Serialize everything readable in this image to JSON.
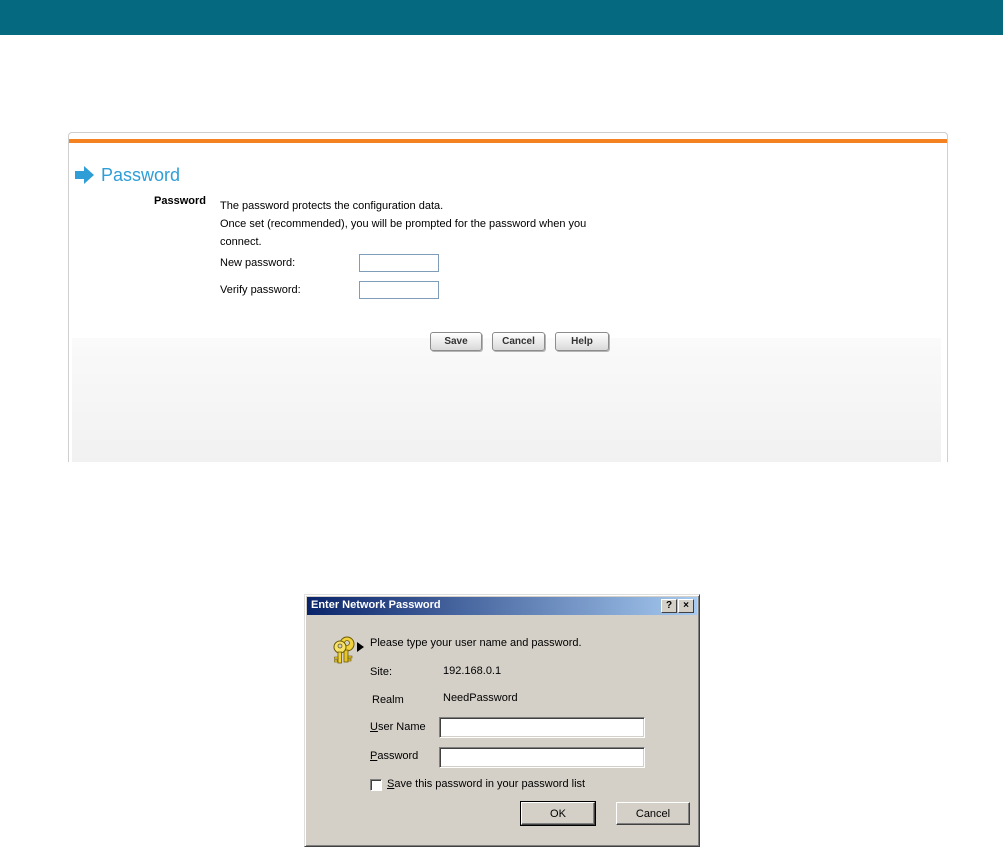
{
  "panel": {
    "title": "Password",
    "section_label": "Password",
    "description": [
      "The password protects the configuration data.",
      "Once set (recommended), you will be prompted for the password when you",
      "connect."
    ],
    "new_password_label": "New password:",
    "verify_password_label": "Verify password:",
    "new_password_value": "",
    "verify_password_value": "",
    "buttons": {
      "save": "Save",
      "cancel": "Cancel",
      "help": "Help"
    },
    "colors": {
      "top_bar": "#056a80",
      "accent_orange": "#f58220",
      "title_blue": "#2f9ed7"
    }
  },
  "dialog": {
    "title": "Enter Network Password",
    "help_button": "?",
    "close_button": "×",
    "prompt": "Please type your user name and password.",
    "site_label": "Site:",
    "site_value": "192.168.0.1",
    "realm_label": "Realm",
    "realm_value": "NeedPassword",
    "user_name_label_mnemonic": "U",
    "user_name_label_rest": "ser Name",
    "user_name_value": "",
    "password_label_mnemonic": "P",
    "password_label_rest": "assword",
    "password_value": "",
    "save_password_mnemonic": "S",
    "save_password_rest": "ave this password in your password list",
    "save_password_checked": false,
    "ok_button": "OK",
    "cancel_button": "Cancel",
    "icon": "keys-icon"
  }
}
